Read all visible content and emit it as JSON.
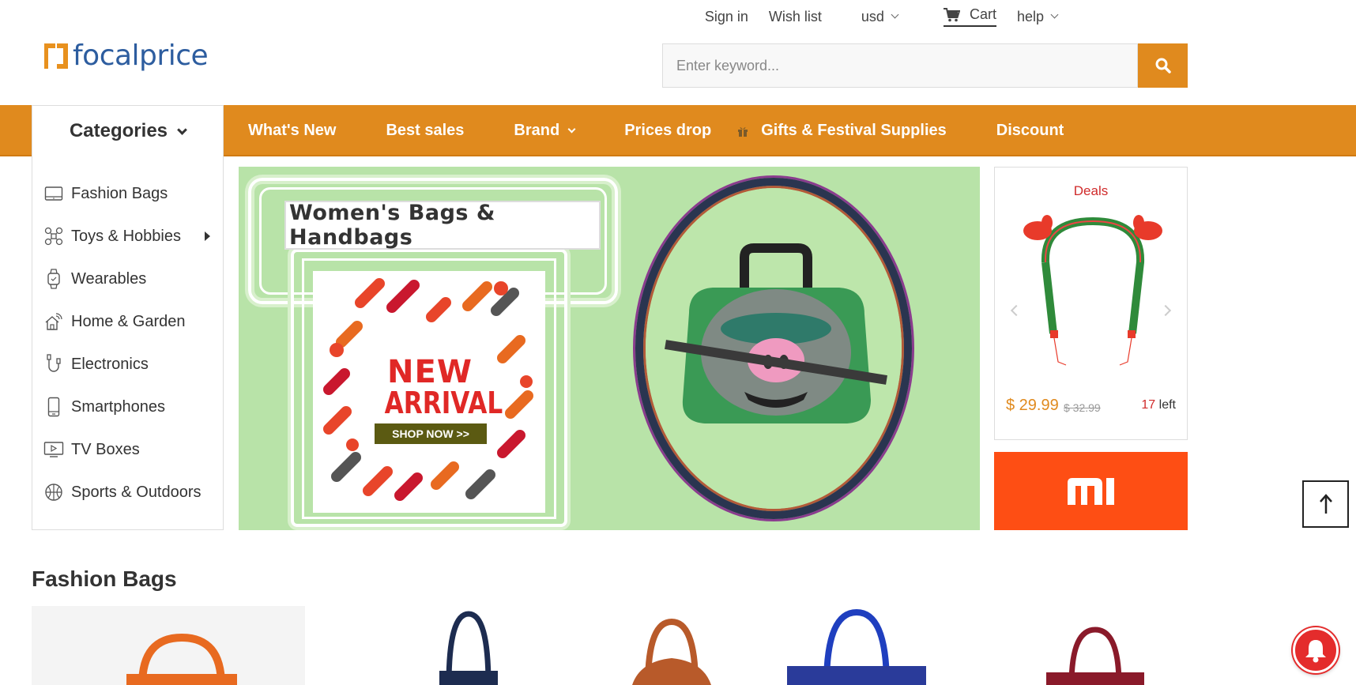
{
  "header": {
    "logo_text": "focalprice",
    "links": {
      "sign_in": "Sign in",
      "wish_list": "Wish list",
      "currency": "usd",
      "cart": "Cart",
      "help": "help"
    },
    "search": {
      "placeholder": "Enter keyword..."
    }
  },
  "nav": {
    "categories_label": "Categories",
    "items": [
      {
        "label": "What's New",
        "has_dropdown": false
      },
      {
        "label": "Best sales",
        "has_dropdown": false
      },
      {
        "label": "Brand",
        "has_dropdown": true
      },
      {
        "label": "Prices drop",
        "has_dropdown": false
      },
      {
        "label": "Gifts & Festival Supplies",
        "has_dropdown": false,
        "icon": "gift-icon"
      },
      {
        "label": "Discount",
        "has_dropdown": false
      }
    ]
  },
  "sidebar": {
    "items": [
      {
        "label": "Fashion Bags",
        "icon": "tablet-icon"
      },
      {
        "label": "Toys & Hobbies",
        "icon": "drone-icon",
        "has_submenu": true
      },
      {
        "label": "Wearables",
        "icon": "watch-icon"
      },
      {
        "label": "Home & Garden",
        "icon": "smart-home-icon"
      },
      {
        "label": "Electronics",
        "icon": "cable-icon"
      },
      {
        "label": "Smartphones",
        "icon": "smartphone-icon"
      },
      {
        "label": "TV Boxes",
        "icon": "tv-box-icon"
      },
      {
        "label": "Sports & Outdoors",
        "icon": "basketball-icon"
      }
    ]
  },
  "banner": {
    "title": "Women's Bags & Handbags",
    "new_line1": "NEW",
    "new_line2": "ARRIVAL",
    "shop_now": "SHOP NOW >>"
  },
  "deals": {
    "title": "Deals",
    "price": "$ 29.99",
    "old_price": "$ 32.99",
    "stock_count": "17",
    "stock_suffix": " left"
  },
  "brand_banner": {
    "icon": "mi-logo-icon"
  },
  "section": {
    "title": "Fashion Bags"
  },
  "colors": {
    "accent": "#e08a1e",
    "logo_blue": "#2d5d9f",
    "deal_red": "#d02b2b",
    "mi_orange": "#fe4e14",
    "banner_green": "#b8e3a8"
  }
}
